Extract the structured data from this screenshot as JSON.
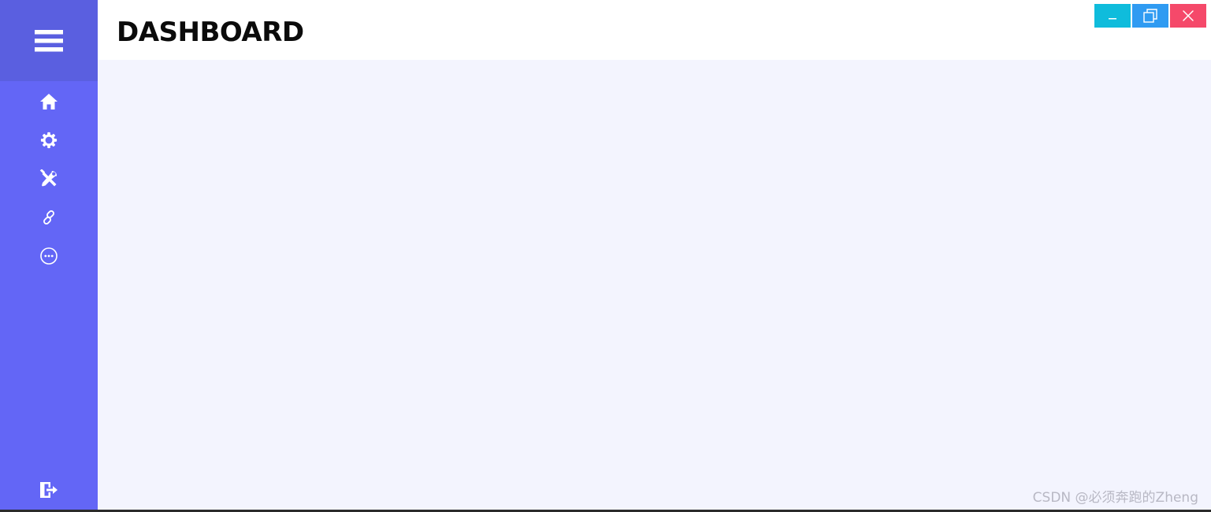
{
  "header": {
    "title": "DASHBOARD"
  },
  "sidebar": {
    "toggle_icon": "hamburger-menu-icon",
    "items": [
      {
        "id": "home",
        "icon": "home-icon"
      },
      {
        "id": "settings",
        "icon": "gear-icon"
      },
      {
        "id": "tools",
        "icon": "tools-icon"
      },
      {
        "id": "links",
        "icon": "link-icon"
      },
      {
        "id": "more",
        "icon": "more-icon"
      }
    ],
    "logout_icon": "logout-icon"
  },
  "window_controls": {
    "minimize_icon": "minimize-icon",
    "restore_icon": "restore-icon",
    "close_icon": "close-icon"
  },
  "watermark": "CSDN @必须奔跑的Zheng",
  "colors": {
    "sidebar": "#6366f6",
    "sidebar_header": "#5a5fe0",
    "content_bg": "#f3f4fe",
    "minimize": "#0fbcdc",
    "restore": "#2f9bf2",
    "close": "#f5496a"
  }
}
